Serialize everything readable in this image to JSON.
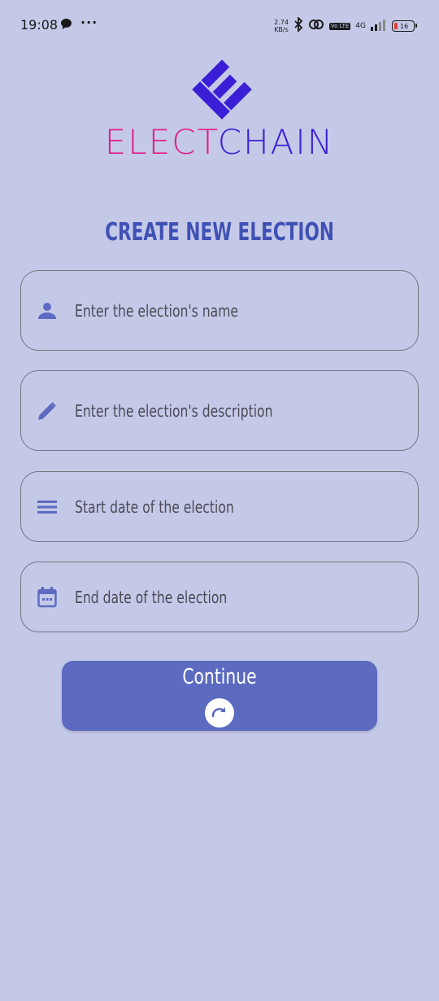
{
  "status_bar": {
    "time": "19:08",
    "net_speed_value": "2.74",
    "net_speed_unit": "KB/s",
    "volte": "Vo LTE",
    "network": "4G",
    "battery_level": "16",
    "icons": [
      "chat-bubble-icon",
      "more-dots-icon",
      "bluetooth-icon",
      "link-icon",
      "signal-icon",
      "battery-icon"
    ]
  },
  "logo": {
    "text_part1": "ELECT",
    "text_part2": "CHAIN",
    "colors": {
      "elect": "#e0208a",
      "chain": "#3b1fd6"
    }
  },
  "page": {
    "title": "CREATE NEW ELECTION"
  },
  "form": {
    "name_placeholder": "Enter the election's name",
    "description_placeholder": "Enter the election's description",
    "start_date_placeholder": "Start date of the election",
    "end_date_placeholder": "End date of the election"
  },
  "continue_button": {
    "label": "Continue",
    "icon": "redo-arrow-icon"
  },
  "colors": {
    "background": "#c5c9e8",
    "accent": "#3f51b5",
    "button": "#5c6bc0"
  }
}
